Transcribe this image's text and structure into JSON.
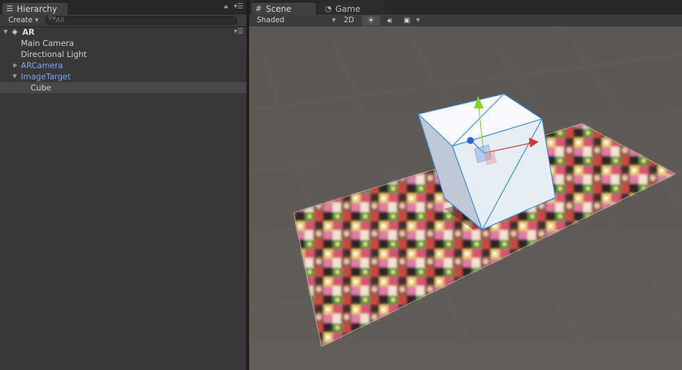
{
  "hierarchy": {
    "tab_label": "Hierarchy",
    "create_label": "Create",
    "search_placeholder": "All",
    "scene_name": "AR",
    "items": [
      {
        "label": "Main Camera"
      },
      {
        "label": "Directional Light"
      },
      {
        "label": "ARCamera"
      },
      {
        "label": "ImageTarget"
      },
      {
        "label": "Cube"
      }
    ]
  },
  "scene": {
    "tab_label": "Scene",
    "game_tab_label": "Game",
    "shading_mode": "Shaded",
    "mode_2d_label": "2D"
  },
  "icons": {
    "hierarchy_tab": "list-icon",
    "scene_tab": "grid-icon",
    "game_tab": "pacman-icon",
    "lighting": "sun-icon",
    "audio": "speaker-icon",
    "effects": "image-icon",
    "lock": "lock-icon",
    "panel_menu": "menu-icon"
  },
  "colors": {
    "prefab_text": "#7aa6ff",
    "selected_row": "#484848",
    "panel_bg": "#383838",
    "scene_bg": "#5d5955",
    "cube_outline": "#2f8ad8",
    "gizmo_x": "#d0382a",
    "gizmo_y": "#8ad12e",
    "gizmo_z": "#2f62d8"
  }
}
